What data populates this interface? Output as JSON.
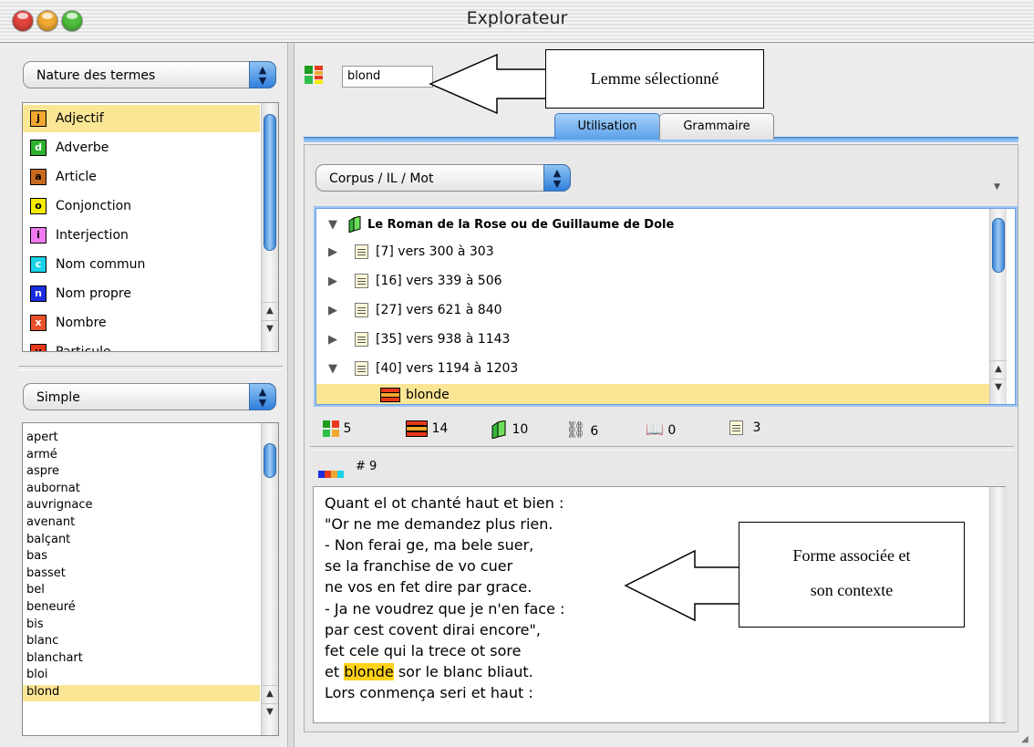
{
  "window": {
    "title": "Explorateur"
  },
  "left": {
    "category_popup": "Nature des termes",
    "categories": [
      {
        "badge": "j",
        "color": "#f0a830",
        "label": "Adjectif"
      },
      {
        "badge": "d",
        "color": "#2eb22e",
        "label": "Adverbe"
      },
      {
        "badge": "a",
        "color": "#c86a1e",
        "label": "Article"
      },
      {
        "badge": "o",
        "color": "#f5ea00",
        "label": "Conjonction"
      },
      {
        "badge": "i",
        "color": "#f07af0",
        "label": "Interjection"
      },
      {
        "badge": "c",
        "color": "#1ad2e8",
        "label": "Nom commun"
      },
      {
        "badge": "n",
        "color": "#1a2ee0",
        "label": "Nom propre"
      },
      {
        "badge": "x",
        "color": "#e8502a",
        "label": "Nombre"
      },
      {
        "badge": "u",
        "color": "#e83a1a",
        "label": "Particule"
      }
    ],
    "mode_popup": "Simple",
    "words": [
      "apert",
      "armé",
      "aspre",
      "aubornat",
      "auvrignace",
      "avenant",
      "balçant",
      "bas",
      "basset",
      "bel",
      "beneuré",
      "bis",
      "blanc",
      "blanchart",
      "bloi",
      "blond"
    ]
  },
  "right": {
    "lemma_value": "blond",
    "callout_top": "Lemme sélectionné",
    "tabs": [
      "Utilisation",
      "Grammaire"
    ],
    "corpus_popup": "Corpus / IL / Mot",
    "tree": {
      "root": "Le Roman de la Rose ou de Guillaume de Dole",
      "items": [
        "[7] vers 300 à 303",
        "[16] vers 339 à 506",
        "[27] vers 621 à 840",
        "[35] vers 938 à 1143",
        "[40] vers 1194 à 1203"
      ],
      "leaf": "blonde"
    },
    "stats": [
      "5",
      "14",
      "10",
      "6",
      "0",
      "3"
    ],
    "occurrence": "# 9",
    "text_lines": [
      "Quant el ot chanté haut et bien :",
      "\"Or ne me demandez plus rien.",
      "- Non ferai ge, ma bele suer,",
      "se la franchise de vo cuer",
      "ne vos en fet dire par grace.",
      "- Ja ne voudrez que je n'en face :",
      "par cest covent dirai encore\",",
      "fet cele qui la trece ot sore"
    ],
    "highlight_line": {
      "before": "et ",
      "word": "blonde",
      "after": " sor le blanc bliaut."
    },
    "last_line": "Lors conmença seri et haut :",
    "callout_bottom": [
      "Forme associée et",
      "son contexte"
    ]
  }
}
